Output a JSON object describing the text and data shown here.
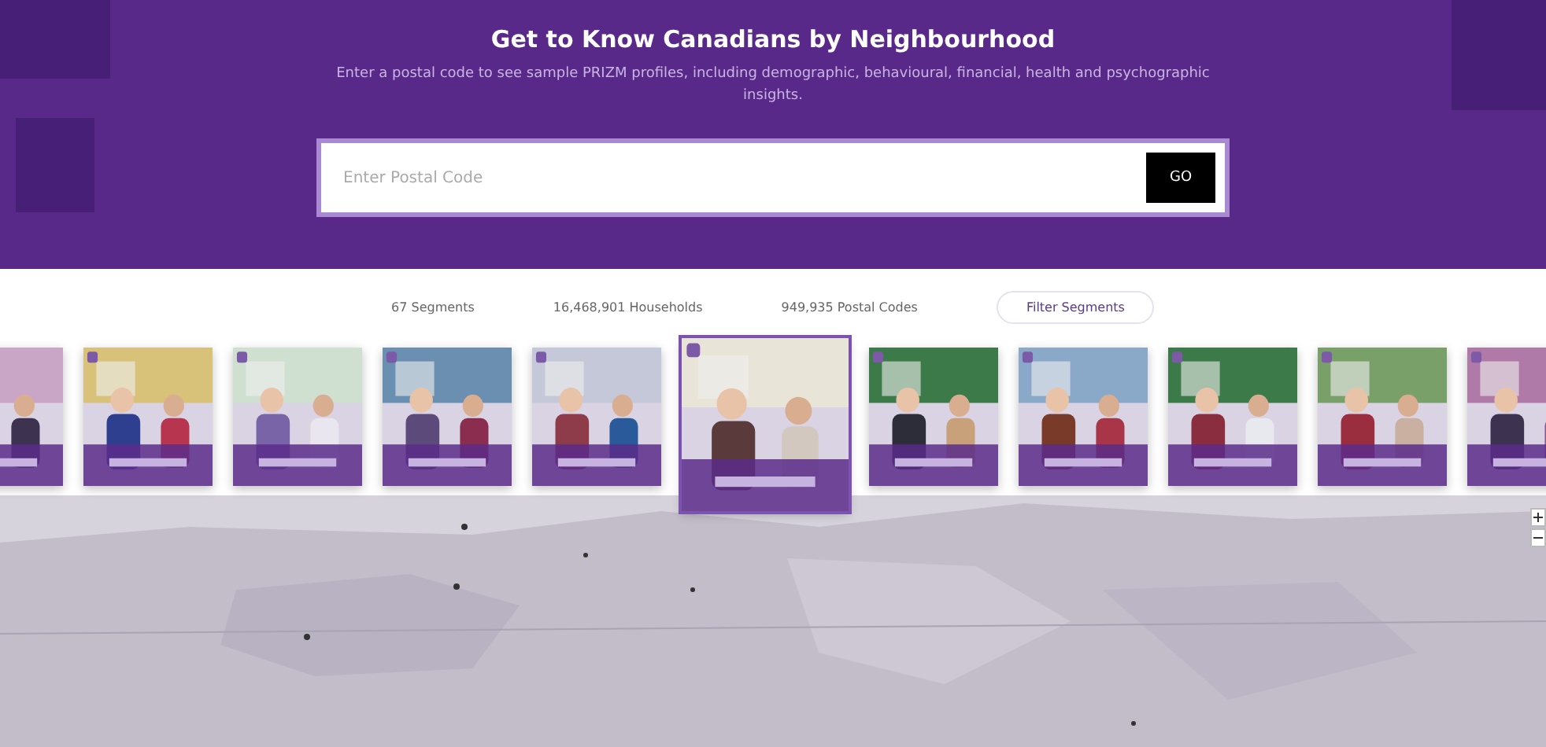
{
  "hero": {
    "title": "Get to Know Canadians by Neighbourhood",
    "subtitle": "Enter a postal code to see sample PRIZM profiles, including demographic, behavioural, financial, health and psychographic insights.",
    "search": {
      "placeholder": "Enter Postal Code"
    },
    "button": "GO"
  },
  "stats": [
    {
      "kind": "text",
      "label": "67 Segments"
    },
    {
      "kind": "text",
      "label": "16,468,901 Households"
    },
    {
      "kind": "text",
      "label": "949,935 Postal Codes"
    },
    {
      "kind": "button",
      "label": "Filter Segments"
    }
  ],
  "segments": [
    {
      "kind": "picture",
      "selected": false
    },
    {
      "kind": "picture",
      "selected": false
    },
    {
      "kind": "picture",
      "selected": false
    },
    {
      "kind": "picture",
      "selected": false
    },
    {
      "kind": "picture",
      "selected": false
    },
    {
      "kind": "picture",
      "selected": true
    },
    {
      "kind": "picture",
      "selected": false
    },
    {
      "kind": "picture",
      "selected": false
    },
    {
      "kind": "picture",
      "selected": false
    },
    {
      "kind": "picture",
      "selected": false
    },
    {
      "kind": "picture",
      "selected": false
    }
  ],
  "map": {
    "kind": "picture"
  }
}
